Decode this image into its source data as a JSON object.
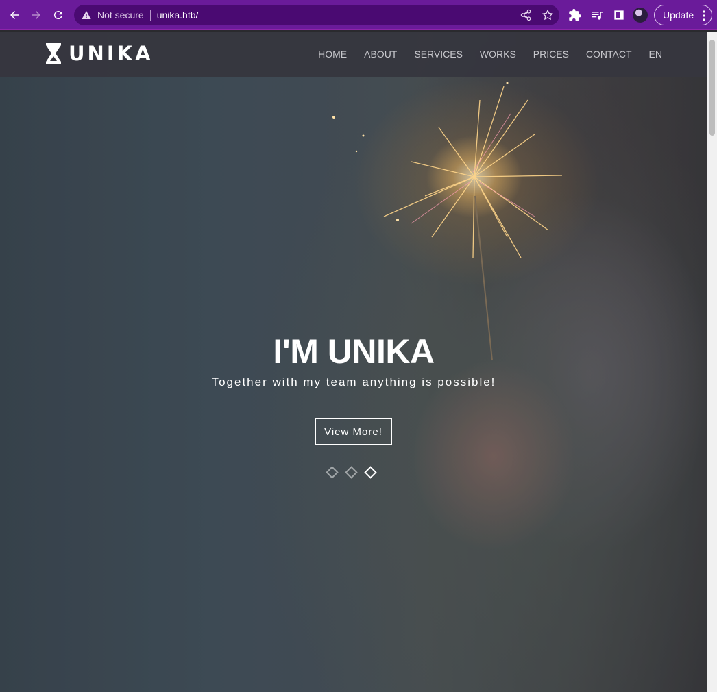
{
  "browser": {
    "security_label": "Not secure",
    "url": "unika.htb/",
    "update_label": "Update",
    "icons": [
      "back-icon",
      "forward-icon",
      "reload-icon",
      "warning-icon",
      "share-icon",
      "star-icon",
      "extensions-icon",
      "media-icon",
      "side-panel-icon",
      "profile-avatar",
      "more-icon"
    ],
    "accent_color": "#6a1b9a"
  },
  "site": {
    "logo_text": "UNIKA",
    "nav": [
      "HOME",
      "ABOUT",
      "SERVICES",
      "WORKS",
      "PRICES",
      "CONTACT",
      "EN"
    ]
  },
  "hero": {
    "title": "I'M UNIKA",
    "subtitle": "Together with my team anything is possible!",
    "cta_label": "View More!",
    "slide_count": 3,
    "active_slide": 3
  }
}
